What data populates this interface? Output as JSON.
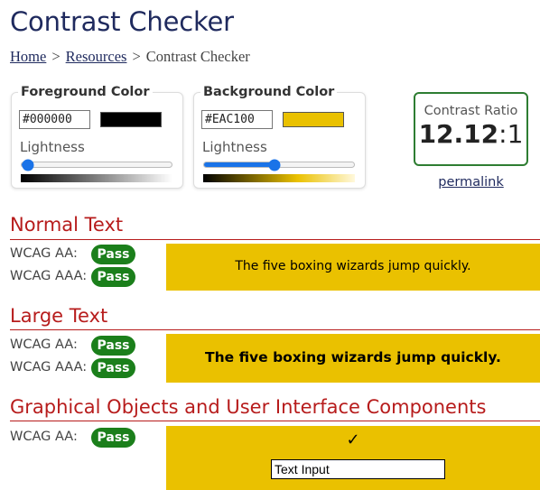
{
  "page": {
    "title": "Contrast Checker"
  },
  "breadcrumb": {
    "home": "Home",
    "resources": "Resources",
    "current": "Contrast Checker",
    "separator": ">"
  },
  "foreground": {
    "legend": "Foreground Color",
    "hex_value": "#000000",
    "swatch_color": "#000000",
    "lightness_label": "Lightness",
    "lightness_percent": 4
  },
  "background": {
    "legend": "Background Color",
    "hex_value": "#EAC100",
    "swatch_color": "#EAC100",
    "lightness_label": "Lightness",
    "lightness_percent": 47
  },
  "ratio": {
    "label": "Contrast Ratio",
    "value_bold": "12.12",
    "value_suffix": ":1",
    "permalink": "permalink"
  },
  "sections": {
    "normal": {
      "heading": "Normal Text",
      "aa_label": "WCAG AA:",
      "aa_result": "Pass",
      "aaa_label": "WCAG AAA:",
      "aaa_result": "Pass",
      "sample": "The five boxing wizards jump quickly."
    },
    "large": {
      "heading": "Large Text",
      "aa_label": "WCAG AA:",
      "aa_result": "Pass",
      "aaa_label": "WCAG AAA:",
      "aaa_result": "Pass",
      "sample": "The five boxing wizards jump quickly."
    },
    "graphical": {
      "heading": "Graphical Objects and User Interface Components",
      "aa_label": "WCAG AA:",
      "aa_result": "Pass",
      "check_glyph": "✓",
      "input_text": "Text Input"
    }
  },
  "colors": {
    "title": "#1f2a5e",
    "section_heading": "#b71c1c",
    "pass_badge": "#1b7f1b",
    "ratio_border": "#2e7d32",
    "slider": "#1a73e8"
  }
}
